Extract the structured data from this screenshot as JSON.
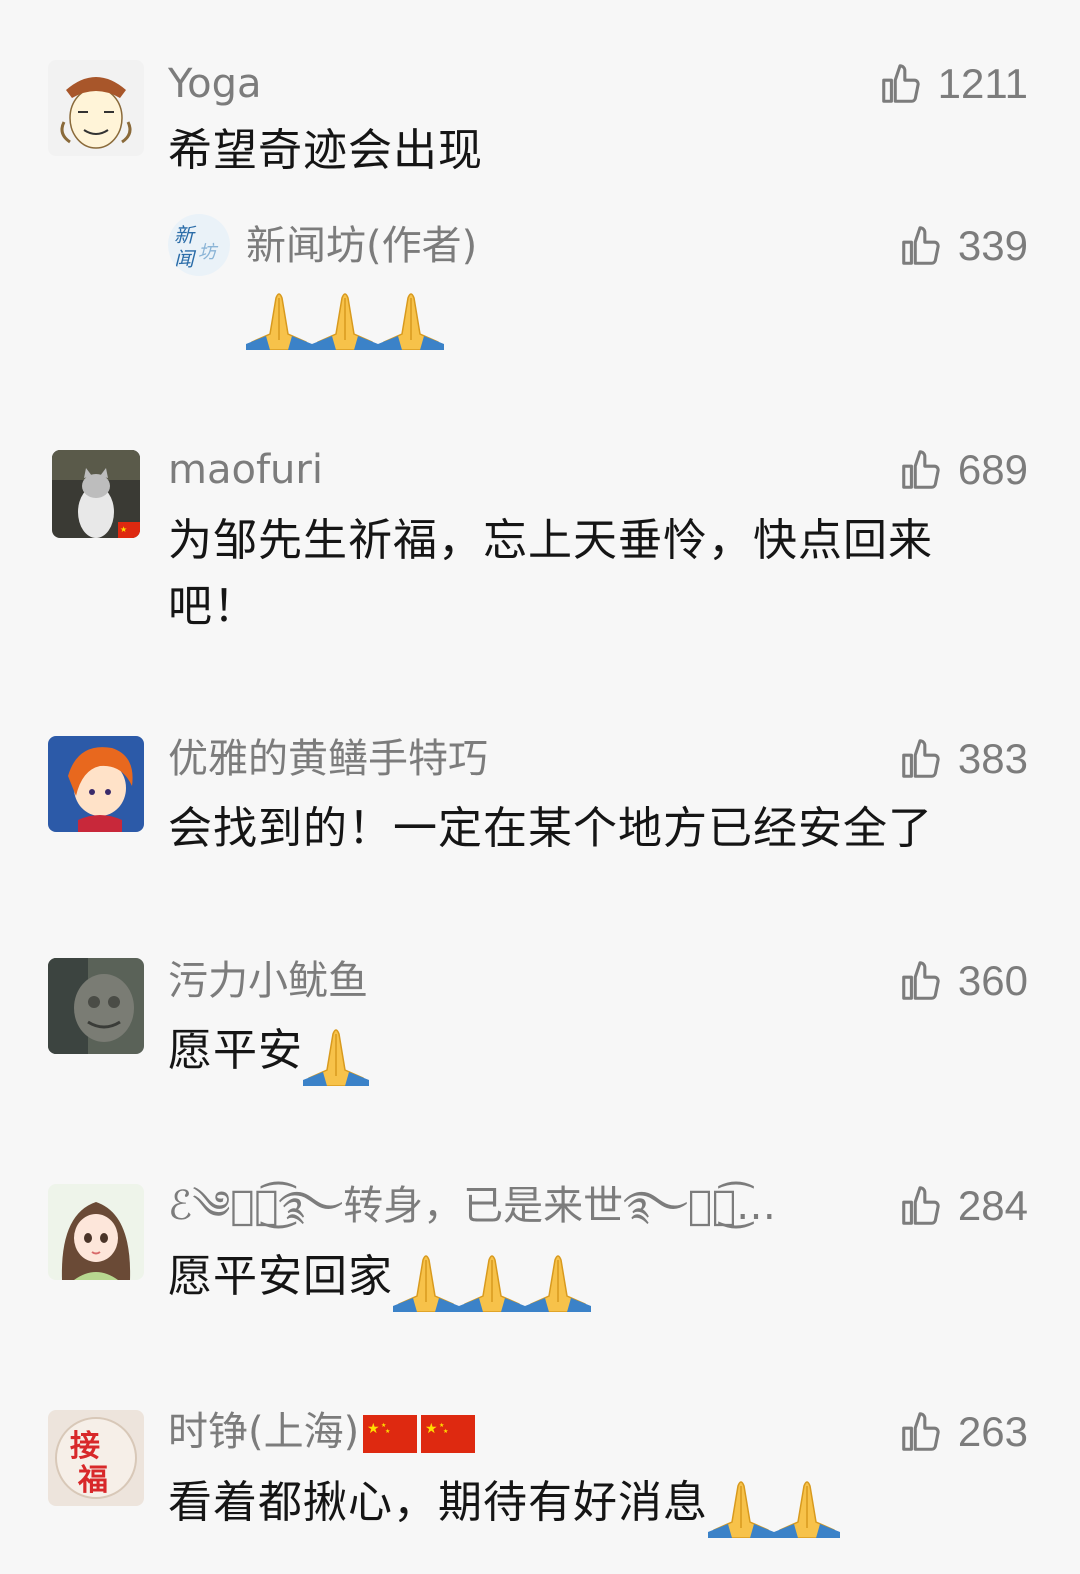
{
  "comments": [
    {
      "username": "Yoga",
      "likes": "1211",
      "text": "希望奇迹会出现",
      "reply": {
        "username": "新闻坊(作者)",
        "likes": "339",
        "emoji": "pray-icon x3"
      }
    },
    {
      "username": "maofuri",
      "likes": "689",
      "text": "为邹先生祈福，忘上天垂怜，快点回来吧！"
    },
    {
      "username": "优雅的黄鳝手特巧",
      "likes": "383",
      "text": "会找到的！一定在某个地方已经安全了"
    },
    {
      "username": "污力小鱿鱼",
      "likes": "360",
      "text": "愿平安"
    },
    {
      "username": "ℰ༄ঔৣ͜͡࿐转身，已是来世࿐ঔৣ͜͡…",
      "likes": "284",
      "text": "愿平安回家"
    },
    {
      "username": "时铮(上海)",
      "likes": "263",
      "text": "看着都揪心，期待有好消息"
    }
  ]
}
